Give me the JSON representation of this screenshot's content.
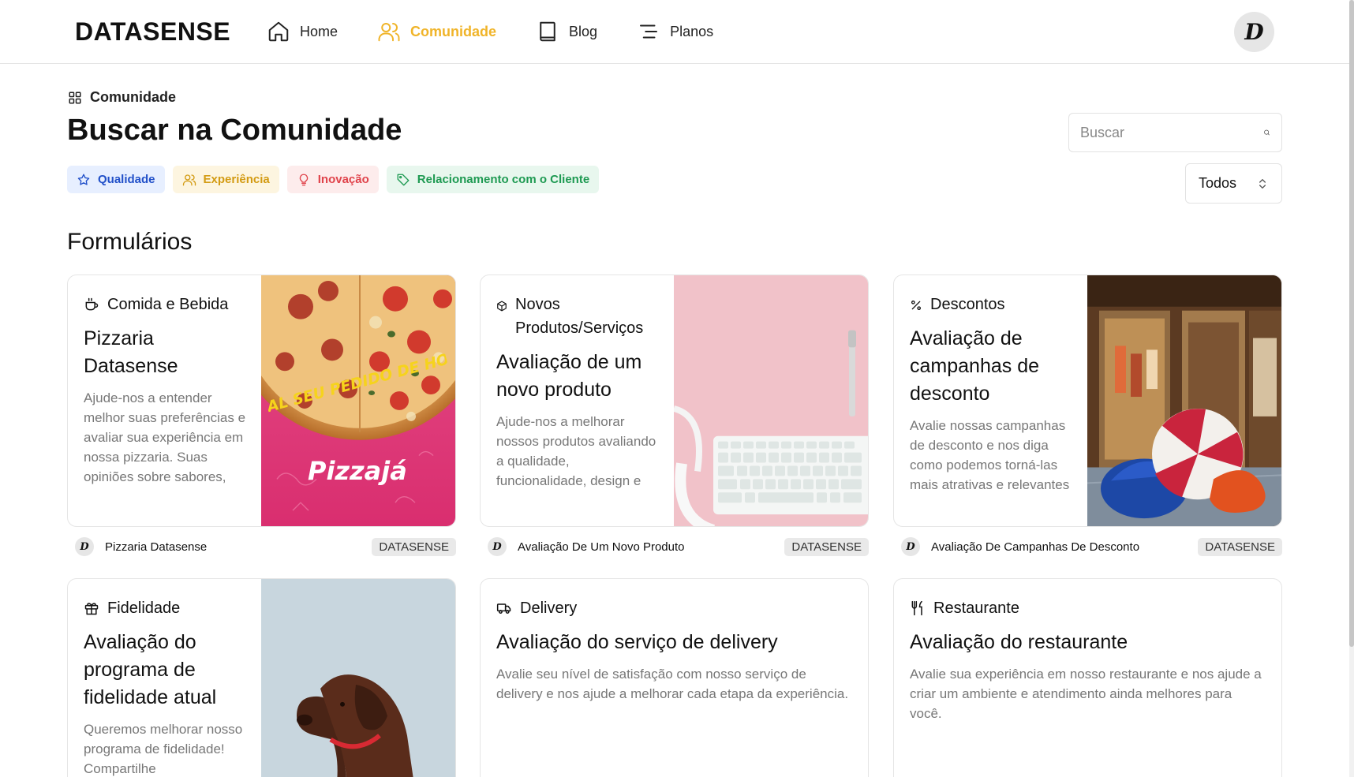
{
  "header": {
    "logo": "DATASENSE",
    "nav": [
      {
        "label": "Home",
        "icon": "home-icon"
      },
      {
        "label": "Comunidade",
        "icon": "users-icon"
      },
      {
        "label": "Blog",
        "icon": "book-icon"
      },
      {
        "label": "Planos",
        "icon": "list-icon"
      }
    ],
    "avatar_initial": "D"
  },
  "page": {
    "breadcrumb": "Comunidade",
    "title": "Buscar na Comunidade",
    "tags": [
      {
        "label": "Qualidade",
        "icon": "star-icon"
      },
      {
        "label": "Experiência",
        "icon": "users-icon"
      },
      {
        "label": "Inovação",
        "icon": "lightbulb-icon"
      },
      {
        "label": "Relacionamento com o Cliente",
        "icon": "tag-icon"
      }
    ],
    "search_placeholder": "Buscar",
    "filter_value": "Todos",
    "section_title": "Formulários"
  },
  "cards": [
    {
      "category": "Comida e Bebida",
      "icon": "cup-icon",
      "title": "Pizzaria Datasense",
      "description": "Ajude-nos a entender melhor suas preferências e avaliar sua experiência em nossa pizzaria. Suas opiniões sobre sabores, qualidade, atendimento...",
      "footer_name": "Pizzaria Datasense",
      "badge": "DATASENSE",
      "image_text_1": "AL SEU PEDIDO DE HO",
      "image_text_2": "Pizzajá"
    },
    {
      "category": "Novos Produtos/Serviços",
      "icon": "box-icon",
      "title": "Avaliação de um novo produto",
      "description": "Ajude-nos a melhorar nossos produtos avaliando a qualidade, funcionalidade, design e preço do novo item. Sua opinião...",
      "footer_name": "Avaliação De Um Novo Produto",
      "badge": "DATASENSE"
    },
    {
      "category": "Descontos",
      "icon": "percent-icon",
      "title": "Avaliação de campanhas de desconto",
      "description": "Avalie nossas campanhas de desconto e nos diga como podemos torná-las mais atrativas e relevantes",
      "footer_name": "Avaliação De Campanhas De Desconto",
      "badge": "DATASENSE"
    },
    {
      "category": "Fidelidade",
      "icon": "gift-icon",
      "title": "Avaliação do programa de fidelidade atual",
      "description": "Queremos melhorar nosso programa de fidelidade! Compartilhe"
    },
    {
      "category": "Delivery",
      "icon": "truck-icon",
      "title": "Avaliação do serviço de delivery",
      "description": "Avalie seu nível de satisfação com nosso serviço de delivery e nos ajude a melhorar cada etapa da experiência."
    },
    {
      "category": "Restaurante",
      "icon": "utensils-icon",
      "title": "Avaliação do restaurante",
      "description": "Avalie sua experiência em nosso restaurante e nos ajude a criar um ambiente e atendimento ainda melhores para você."
    }
  ]
}
